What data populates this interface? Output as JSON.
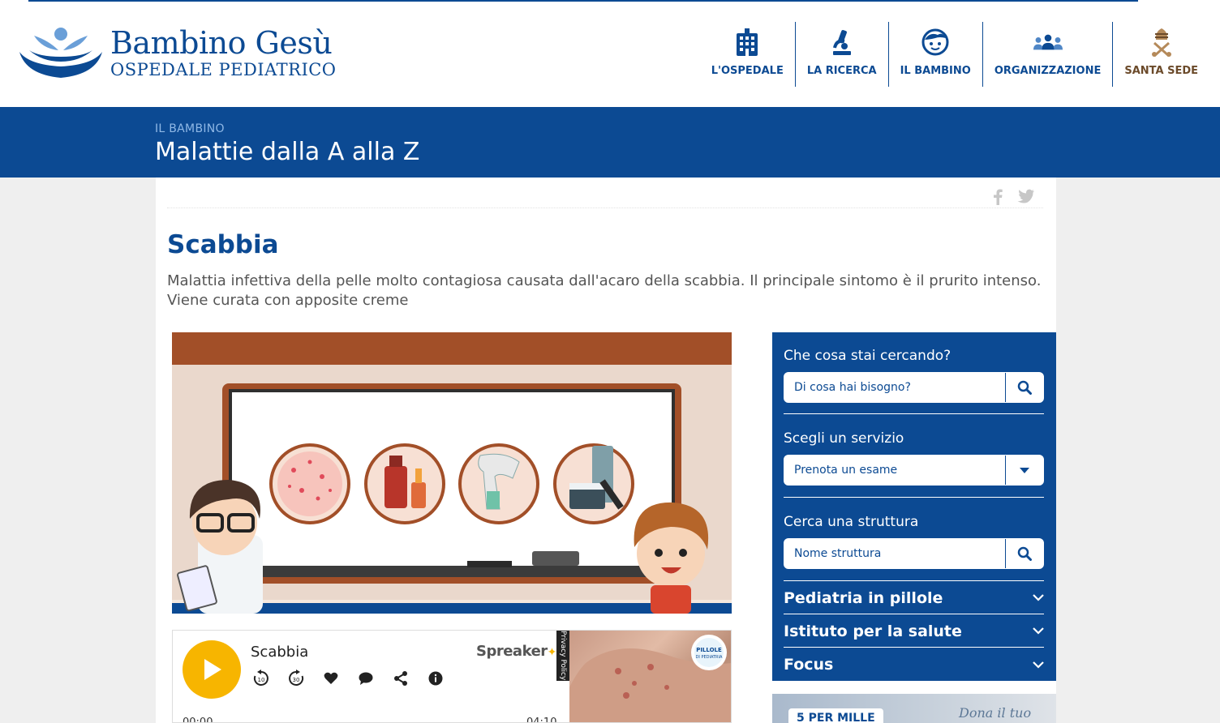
{
  "header": {
    "logo_line1": "Bambino Gesù",
    "logo_line2": "OSPEDALE PEDIATRICO",
    "brand_color": "#0c4a93",
    "nav": [
      {
        "label": "L'OSPEDALE",
        "icon": "hospital-building-icon"
      },
      {
        "label": "LA RICERCA",
        "icon": "microscope-icon"
      },
      {
        "label": "IL BAMBINO",
        "icon": "child-face-icon"
      },
      {
        "label": "ORGANIZZAZIONE",
        "icon": "people-group-icon"
      },
      {
        "label": "SANTA SEDE",
        "icon": "papal-coat-of-arms-icon"
      }
    ]
  },
  "band": {
    "section": "IL BAMBINO",
    "title": "Malattie dalla A alla Z"
  },
  "article": {
    "title": "Scabbia",
    "intro": "Malattia infettiva della pelle molto contagiosa causata dall'acaro della scabbia. Il principale sintomo è il prurito intenso. Viene curata con apposite creme",
    "share_icons": [
      "facebook-icon",
      "twitter-icon"
    ]
  },
  "player": {
    "title": "Scabbia",
    "brand": "Spreaker",
    "time_start": "00:00",
    "time_end": "04:10",
    "privacy": "Privacy Policy",
    "accent": "#f7b500",
    "controls": [
      "rewind-10-icon",
      "forward-30-icon",
      "heart-icon",
      "comment-icon",
      "share-icon",
      "info-icon"
    ]
  },
  "sidebar": {
    "search_label": "Che cosa stai cercando?",
    "search_placeholder": "Di cosa hai bisogno?",
    "service_label": "Scegli un servizio",
    "service_selected": "Prenota un esame",
    "structure_label": "Cerca una struttura",
    "structure_placeholder": "Nome struttura",
    "accordions": [
      "Pediatria in pillole",
      "Istituto per la salute",
      "Focus"
    ]
  },
  "banner": {
    "tag": "5 PER MILLE",
    "script": "Dona il tuo"
  }
}
